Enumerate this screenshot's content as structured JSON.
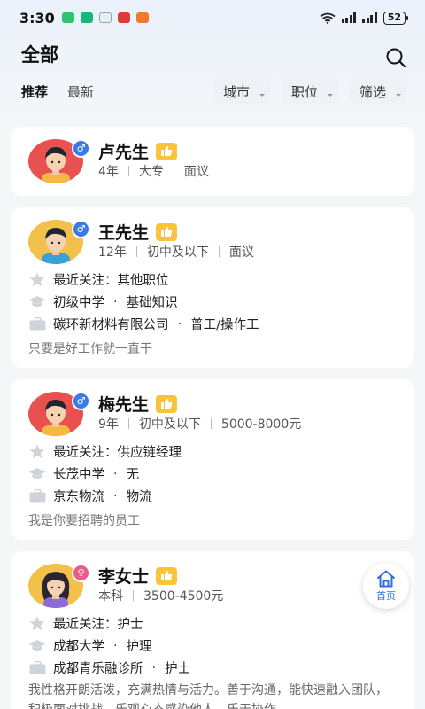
{
  "status_bar": {
    "time": "3:30",
    "battery": "52"
  },
  "header": {
    "title": "全部",
    "tabs": [
      "推荐",
      "最新"
    ],
    "filters": [
      "城市",
      "职位",
      "筛选"
    ]
  },
  "candidates": [
    {
      "name": "卢先生",
      "gender": "male",
      "meta": [
        "4年",
        "大专",
        "面议"
      ]
    },
    {
      "name": "王先生",
      "gender": "male",
      "meta": [
        "12年",
        "初中及以下",
        "面议"
      ],
      "focus": "最近关注：其他职位",
      "school": "初级中学",
      "major": "基础知识",
      "company": "碳环新材料有限公司",
      "position": "普工/操作工",
      "desc": "只要是好工作就一直干"
    },
    {
      "name": "梅先生",
      "gender": "male",
      "meta": [
        "9年",
        "初中及以下",
        "5000-8000元"
      ],
      "focus": "最近关注：供应链经理",
      "school": "长茂中学",
      "major": "无",
      "company": "京东物流",
      "position": "物流",
      "desc": "我是你要招聘的员工"
    },
    {
      "name": "李女士",
      "gender": "female",
      "meta": [
        "本科",
        "3500-4500元"
      ],
      "focus": "最近关注：护士",
      "school": "成都大学",
      "major": "护理",
      "company": "成都青乐融诊所",
      "position": "护士",
      "desc": "我性格开朗活泼，充满热情与活力。善于沟通，能快速融入团队，积极面对挑战，乐观心态感染他人，乐于协作…"
    }
  ],
  "fab": {
    "label": "首页"
  },
  "colors": {
    "accent": "#2f6fe0",
    "male": "#3a7ae8",
    "female": "#ea5d8a",
    "badge": "#f8c43a"
  }
}
